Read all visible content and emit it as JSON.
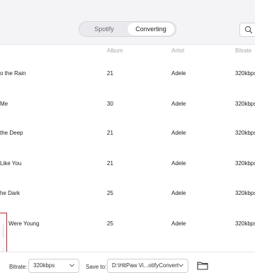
{
  "tabs": {
    "spotify": "Spotify",
    "converting": "Converting",
    "active": "Converting"
  },
  "columns": {
    "album": "Album",
    "artist": "Artist",
    "bitrate": "Bitrate"
  },
  "rows": [
    {
      "title": "o the Rain",
      "album": "21",
      "artist": "Adele",
      "bitrate": "320kbps"
    },
    {
      "title": "Me",
      "album": "30",
      "artist": "Adele",
      "bitrate": "320kbps"
    },
    {
      "title": "the Deep",
      "album": "21",
      "artist": "Adele",
      "bitrate": "320kbps"
    },
    {
      "title": "Like You",
      "album": "21",
      "artist": "Adele",
      "bitrate": "320kbps"
    },
    {
      "title": "he Dark",
      "album": "25",
      "artist": "Adele",
      "bitrate": "320kbps"
    },
    {
      "title": "Were Young",
      "album": "25",
      "artist": "Adele",
      "bitrate": "320kbps"
    }
  ],
  "footer": {
    "bitrate_label": "Bitrate:",
    "bitrate_value": "320kbps",
    "save_label": "Save to:",
    "save_value": "D:\\HitPaw Vi...otifyConvert"
  },
  "icons": {
    "search": "search-icon",
    "folder": "folder-icon",
    "chevron": "chevron-down-icon"
  },
  "colors": {
    "highlight_border": "#c8202a"
  }
}
